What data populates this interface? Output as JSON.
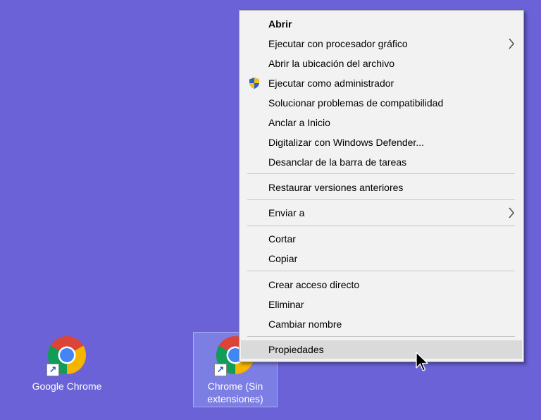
{
  "desktop": {
    "icons": [
      {
        "label": "Google Chrome"
      },
      {
        "label_line1": "Chrome (Sin",
        "label_line2": "extensiones)"
      }
    ]
  },
  "context_menu": {
    "items": [
      {
        "label": "Abrir"
      },
      {
        "label": "Ejecutar con procesador gráfico"
      },
      {
        "label": "Abrir la ubicación del archivo"
      },
      {
        "label": "Ejecutar como administrador"
      },
      {
        "label": "Solucionar problemas de compatibilidad"
      },
      {
        "label": "Anclar a Inicio"
      },
      {
        "label": "Digitalizar con Windows Defender..."
      },
      {
        "label": "Desanclar de la barra de tareas"
      },
      {
        "label": "Restaurar versiones anteriores"
      },
      {
        "label": "Enviar a"
      },
      {
        "label": "Cortar"
      },
      {
        "label": "Copiar"
      },
      {
        "label": "Crear acceso directo"
      },
      {
        "label": "Eliminar"
      },
      {
        "label": "Cambiar nombre"
      },
      {
        "label": "Propiedades"
      }
    ]
  },
  "icons": {
    "submenu_arrow": "chevron-right-icon",
    "admin": "uac-shield-icon",
    "app": "chrome-logo-icon",
    "shortcut": "shortcut-arrow-icon",
    "pointer": "mouse-cursor-icon"
  },
  "colors": {
    "desktop_background": "#6a62d6",
    "menu_background": "#f2f2f2",
    "hover_background": "#dadada",
    "selection_highlight": "#a0b4ff"
  }
}
